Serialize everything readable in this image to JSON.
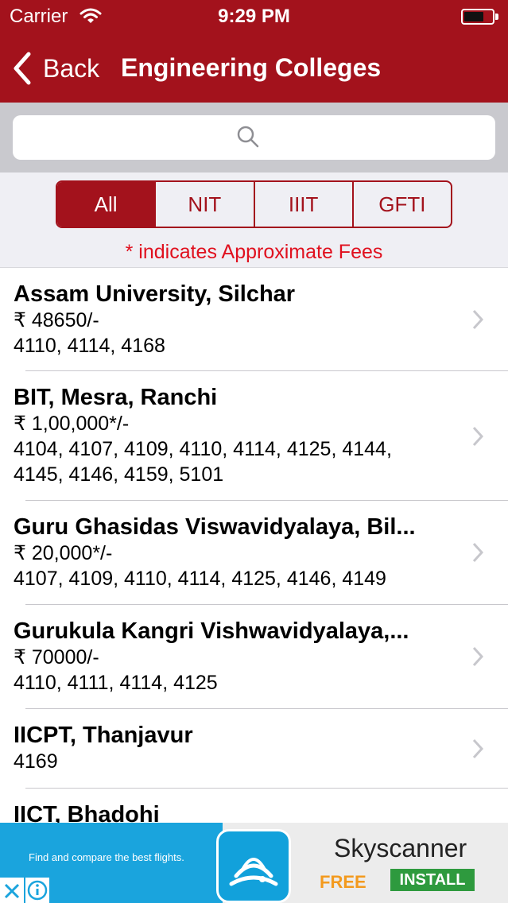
{
  "status_bar": {
    "carrier": "Carrier",
    "time": "9:29 PM"
  },
  "nav": {
    "back_label": "Back",
    "title": "Engineering Colleges"
  },
  "search": {
    "placeholder": ""
  },
  "filters": {
    "segments": [
      {
        "label": "All",
        "selected": true
      },
      {
        "label": "NIT",
        "selected": false
      },
      {
        "label": "IIIT",
        "selected": false
      },
      {
        "label": "GFTI",
        "selected": false
      }
    ],
    "note": "* indicates Approximate Fees"
  },
  "colleges": [
    {
      "name": "Assam University, Silchar",
      "lines": [
        "₹ 48650/-",
        "4110, 4114, 4168"
      ]
    },
    {
      "name": "BIT, Mesra, Ranchi",
      "lines": [
        "₹ 1,00,000*/-",
        "4104, 4107, 4109, 4110, 4114, 4125, 4144,",
        "4145, 4146, 4159, 5101"
      ]
    },
    {
      "name": "Guru Ghasidas Viswavidyalaya, Bil...",
      "lines": [
        "₹ 20,000*/-",
        "4107, 4109, 4110, 4114, 4125, 4146, 4149"
      ]
    },
    {
      "name": "Gurukula Kangri Vishwavidyalaya,...",
      "lines": [
        "₹ 70000/-",
        "4110, 4111, 4114, 4125"
      ]
    },
    {
      "name": "IICPT, Thanjavur",
      "lines": [
        "4169"
      ]
    },
    {
      "name": "IICT, Bhadohi",
      "lines": []
    }
  ],
  "ad": {
    "tagline": "Find and compare the best flights.",
    "brand": "Skyscanner",
    "free_label": "FREE",
    "install_label": "INSTALL"
  },
  "colors": {
    "brand_red": "#a3121c",
    "note_red": "#e0101e",
    "ad_blue": "#1aa4dd",
    "ad_install_green": "#2e9a3e",
    "ad_free_orange": "#f39a1e"
  }
}
